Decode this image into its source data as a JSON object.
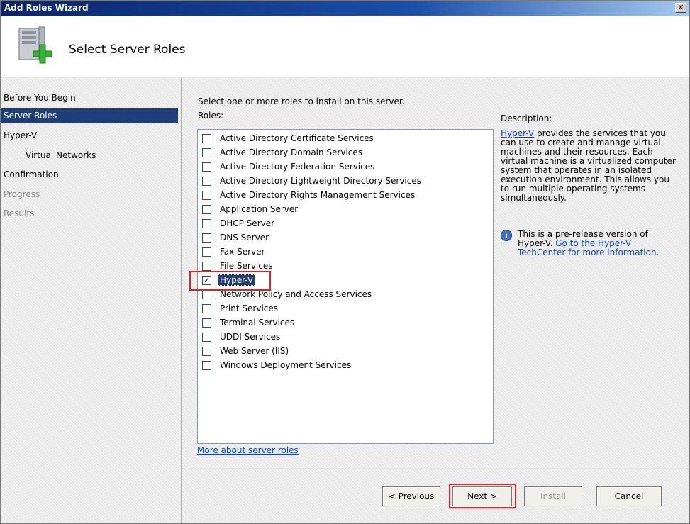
{
  "window": {
    "title": "Add Roles Wizard",
    "close_glyph": "✕"
  },
  "header": {
    "title": "Select Server Roles"
  },
  "sidebar": {
    "items": [
      {
        "label": "Before You Begin",
        "state": "normal"
      },
      {
        "label": "Server Roles",
        "state": "active"
      },
      {
        "label": "Hyper-V",
        "state": "normal"
      },
      {
        "label": "Virtual Networks",
        "state": "normal"
      },
      {
        "label": "Confirmation",
        "state": "normal"
      },
      {
        "label": "Progress",
        "state": "disabled"
      },
      {
        "label": "Results",
        "state": "disabled"
      }
    ]
  },
  "main": {
    "instruction": "Select one or more roles to install on this server.",
    "roles_label": "Roles:",
    "roles": [
      {
        "label": "Active Directory Certificate Services",
        "checked": false
      },
      {
        "label": "Active Directory Domain Services",
        "checked": false
      },
      {
        "label": "Active Directory Federation Services",
        "checked": false
      },
      {
        "label": "Active Directory Lightweight Directory Services",
        "checked": false
      },
      {
        "label": "Active Directory Rights Management Services",
        "checked": false
      },
      {
        "label": "Application Server",
        "checked": false
      },
      {
        "label": "DHCP Server",
        "checked": false
      },
      {
        "label": "DNS Server",
        "checked": false
      },
      {
        "label": "Fax Server",
        "checked": false
      },
      {
        "label": "File Services",
        "checked": false
      },
      {
        "label": "Hyper-V",
        "checked": true
      },
      {
        "label": "Network Policy and Access Services",
        "checked": false
      },
      {
        "label": "Print Services",
        "checked": false
      },
      {
        "label": "Terminal Services",
        "checked": false
      },
      {
        "label": "UDDI Services",
        "checked": false
      },
      {
        "label": "Web Server (IIS)",
        "checked": false
      },
      {
        "label": "Windows Deployment Services",
        "checked": false
      }
    ],
    "more_link": "More about server roles",
    "description_label": "Description:",
    "description_link": "Hyper-V",
    "description_text": " provides the services that you can use to create and manage virtual machines and their resources. Each virtual machine is a virtualized computer system that operates in an isolated execution environment. This allows you to run multiple operating systems simultaneously.",
    "note_text": "This is a pre-release version of Hyper-V. ",
    "note_link": "Go to the Hyper-V TechCenter for more information."
  },
  "footer": {
    "previous_label": "< Previous",
    "next_label": "Next >",
    "install_label": "Install",
    "cancel_label": "Cancel"
  },
  "colors": {
    "highlight_box": "#e0202a",
    "selection": "#1e3e7a",
    "link": "#0645c8"
  }
}
